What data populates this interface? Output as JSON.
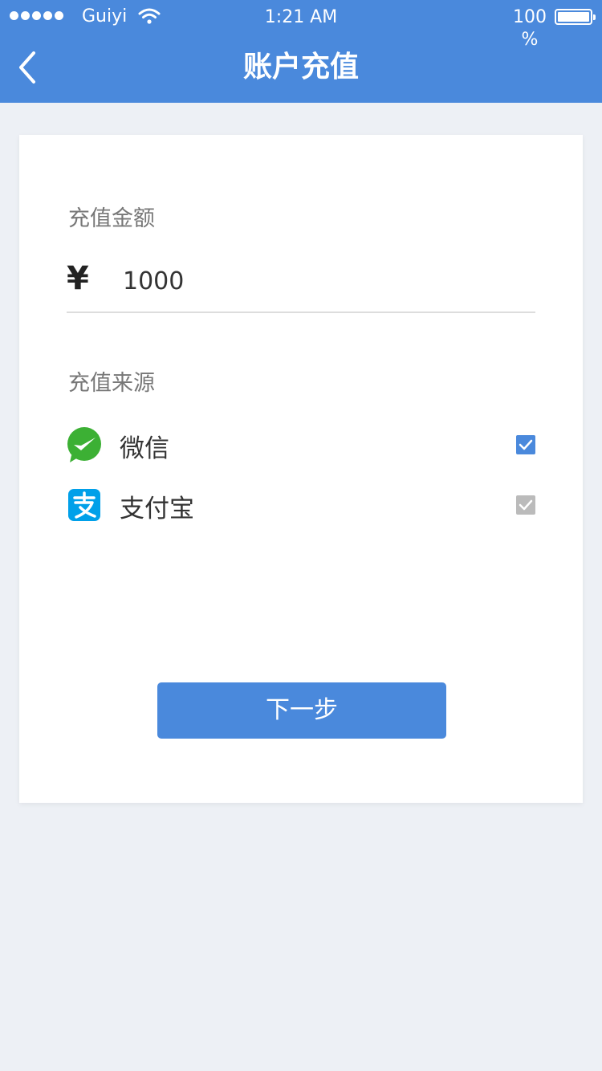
{
  "status_bar": {
    "carrier": "Guiyi",
    "time": "1:21 AM",
    "battery": "100 %",
    "signal_icon": "signal-dots-icon",
    "wifi_icon": "wifi-icon",
    "battery_icon": "battery-icon"
  },
  "header": {
    "title": "账户充值",
    "back_icon": "chevron-left-icon"
  },
  "form": {
    "amount_label": "充值金额",
    "currency_symbol": "¥",
    "amount_value": "1000",
    "source_label": "充值来源",
    "sources": [
      {
        "label": "微信",
        "icon": "wechat-pay-icon",
        "checked": true,
        "check_color": "#4a89dc"
      },
      {
        "label": "支付宝",
        "icon": "alipay-icon",
        "checked": true,
        "check_color": "#bbbbbb"
      }
    ],
    "next_button": "下一步"
  },
  "colors": {
    "primary": "#4a89dc",
    "background": "#edf0f5",
    "wechat_green": "#3cb034",
    "alipay_blue": "#00a0e9"
  }
}
